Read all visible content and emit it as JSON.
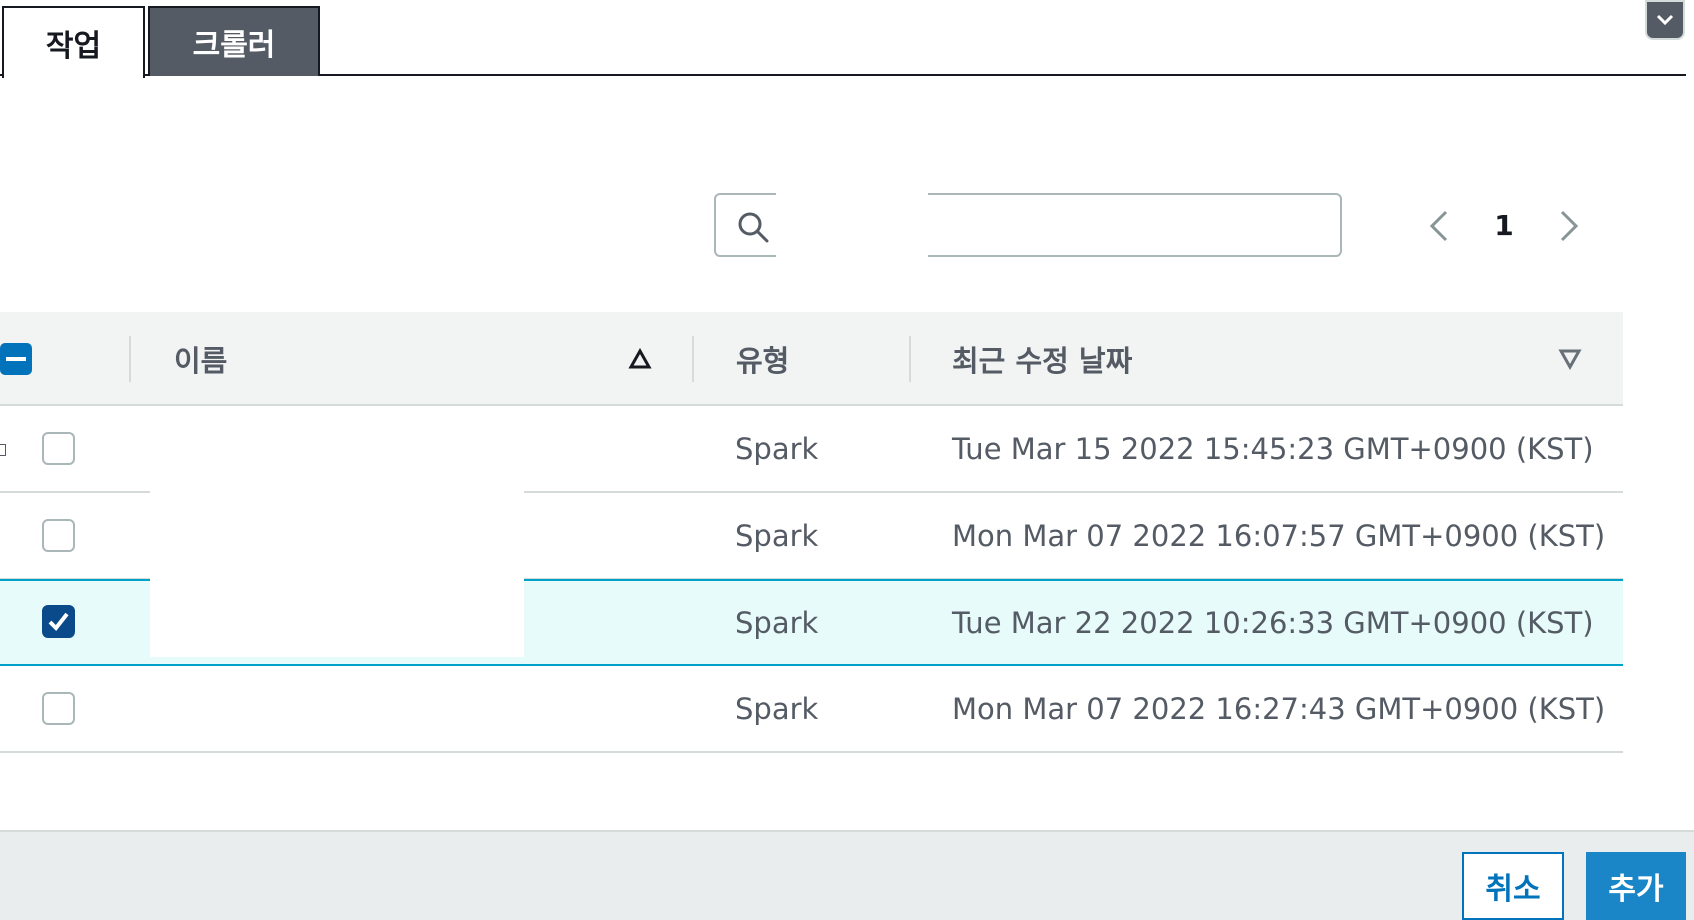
{
  "tabs": [
    {
      "label": "작업",
      "active": true
    },
    {
      "label": "크롤러",
      "active": false
    }
  ],
  "search": {
    "placeholder": "",
    "value": ""
  },
  "pagination": {
    "current_page": "1"
  },
  "table": {
    "columns": {
      "name": "이름",
      "type": "유형",
      "modified": "최근 수정 날짜"
    },
    "rows": [
      {
        "type": "Spark",
        "modified": "Tue Mar 15 2022 15:45:23 GMT+0900 (KST)",
        "checked": false
      },
      {
        "type": "Spark",
        "modified": "Mon Mar 07 2022 16:07:57 GMT+0900 (KST)",
        "checked": false
      },
      {
        "type": "Spark",
        "modified": "Tue Mar 22 2022 10:26:33 GMT+0900 (KST)",
        "checked": true
      },
      {
        "type": "Spark",
        "modified": "Mon Mar 07 2022 16:27:43 GMT+0900 (KST)",
        "checked": false
      }
    ]
  },
  "footer": {
    "cancel_label": "취소",
    "add_label": "추가"
  },
  "colors": {
    "accent": "#0073bb",
    "selected_row": "#e7fbfb",
    "tab_inactive": "#545b64"
  }
}
